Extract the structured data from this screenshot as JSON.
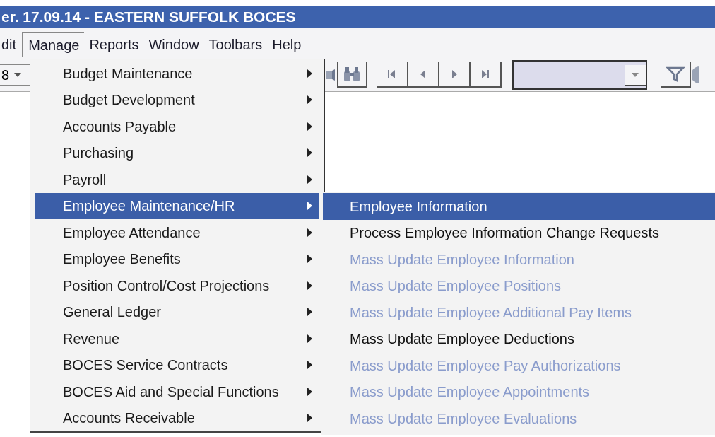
{
  "window": {
    "title": "er. 17.09.14 - EASTERN SUFFOLK BOCES"
  },
  "menubar": [
    {
      "label": "dit",
      "selected": false
    },
    {
      "label": "Manage",
      "selected": true
    },
    {
      "label": "Reports",
      "selected": false
    },
    {
      "label": "Window",
      "selected": false
    },
    {
      "label": "Toolbars",
      "selected": false
    },
    {
      "label": "Help",
      "selected": false
    }
  ],
  "toolbar": {
    "combo_value": "8"
  },
  "manage_menu": [
    {
      "label": "Budget Maintenance",
      "selected": false
    },
    {
      "label": "Budget Development",
      "selected": false
    },
    {
      "label": "Accounts Payable",
      "selected": false
    },
    {
      "label": "Purchasing",
      "selected": false
    },
    {
      "label": "Payroll",
      "selected": false
    },
    {
      "label": "Employee Maintenance/HR",
      "selected": true
    },
    {
      "label": "Employee Attendance",
      "selected": false
    },
    {
      "label": "Employee Benefits",
      "selected": false
    },
    {
      "label": "Position Control/Cost Projections",
      "selected": false
    },
    {
      "label": "General Ledger",
      "selected": false
    },
    {
      "label": "Revenue",
      "selected": false
    },
    {
      "label": "BOCES Service Contracts",
      "selected": false
    },
    {
      "label": "BOCES Aid and Special Functions",
      "selected": false
    },
    {
      "label": "Accounts Receivable",
      "selected": false
    }
  ],
  "submenu": [
    {
      "label": "Employee Information",
      "selected": true,
      "disabled": false
    },
    {
      "label": "Process Employee Information Change Requests",
      "selected": false,
      "disabled": false
    },
    {
      "label": "Mass Update Employee Information",
      "selected": false,
      "disabled": true
    },
    {
      "label": "Mass Update Employee Positions",
      "selected": false,
      "disabled": true
    },
    {
      "label": "Mass Update Employee Additional Pay Items",
      "selected": false,
      "disabled": true
    },
    {
      "label": "Mass Update Employee Deductions",
      "selected": false,
      "disabled": false
    },
    {
      "label": "Mass Update Employee Pay Authorizations",
      "selected": false,
      "disabled": true
    },
    {
      "label": "Mass Update Employee Appointments",
      "selected": false,
      "disabled": true
    },
    {
      "label": "Mass Update Employee Evaluations",
      "selected": false,
      "disabled": true
    }
  ]
}
